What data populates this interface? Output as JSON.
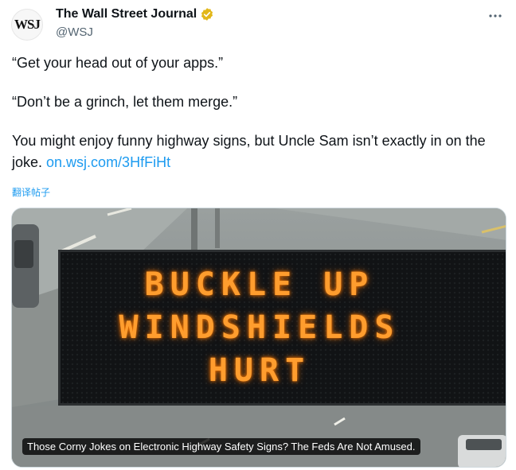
{
  "author": {
    "avatar_text": "WSJ",
    "display_name": "The Wall Street Journal",
    "handle": "@WSJ",
    "verified_color": "#e2b719"
  },
  "tweet": {
    "line1": "“Get your head out of your apps.”",
    "line2": "“Don’t be a grinch, let them merge.”",
    "line3_text": "You might enjoy funny highway signs, but Uncle Sam isn’t exactly in on the joke. ",
    "line3_link": "on.wsj.com/3HfFiHt",
    "translate_label": "翻译帖子"
  },
  "media": {
    "sign_lines": [
      "BUCKLE UP",
      "WINDSHIELDS",
      "HURT"
    ],
    "caption": "Those Corny Jokes on Electronic Highway Safety Signs? The Feds Are Not Amused."
  },
  "icons": {
    "more": "more-horizontal-icon",
    "verified": "verified-badge-icon"
  },
  "colors": {
    "link": "#1d9bf0",
    "sign_led": "#ff9d2e"
  }
}
